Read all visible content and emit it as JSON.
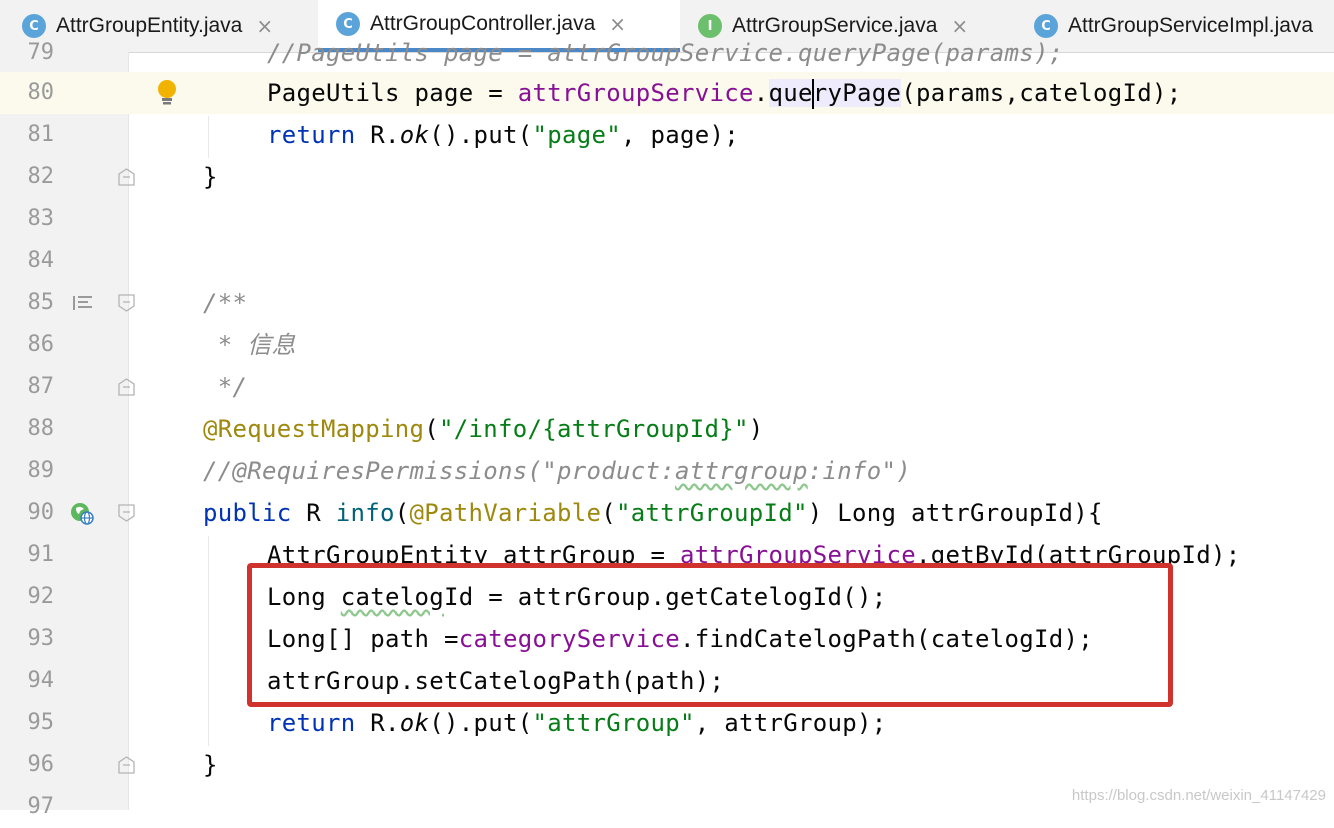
{
  "tabs": [
    {
      "label": "AttrGroupEntity.java",
      "icon": "C",
      "active": false
    },
    {
      "label": "AttrGroupController.java",
      "icon": "C",
      "active": true
    },
    {
      "label": "AttrGroupService.java",
      "icon": "I",
      "active": false
    },
    {
      "label": "AttrGroupServiceImpl.java",
      "icon": "C",
      "active": false
    }
  ],
  "tab_close_glyph": "×",
  "lines": [
    {
      "num": "79",
      "text": "//PageUtils page = attrGroupService.queryPage(params);"
    },
    {
      "num": "80",
      "text": "PageUtils page = attrGroupService.queryPage(params,catelogId);"
    },
    {
      "num": "81",
      "text": "return R.ok().put(\"page\", page);"
    },
    {
      "num": "82",
      "text": "}"
    },
    {
      "num": "83",
      "text": ""
    },
    {
      "num": "84",
      "text": ""
    },
    {
      "num": "85",
      "text": "/**"
    },
    {
      "num": "86",
      "text": " * 信息"
    },
    {
      "num": "87",
      "text": " */"
    },
    {
      "num": "88",
      "text": "@RequestMapping(\"/info/{attrGroupId}\")"
    },
    {
      "num": "89",
      "text": "//@RequiresPermissions(\"product:attrgroup:info\")"
    },
    {
      "num": "90",
      "text": "public R info(@PathVariable(\"attrGroupId\") Long attrGroupId){"
    },
    {
      "num": "91",
      "text": "AttrGroupEntity attrGroup = attrGroupService.getById(attrGroupId);"
    },
    {
      "num": "92",
      "text": "Long catelogId = attrGroup.getCatelogId();"
    },
    {
      "num": "93",
      "text": "Long[] path =categoryService.findCatelogPath(catelogId);"
    },
    {
      "num": "94",
      "text": "attrGroup.setCatelogPath(path);"
    },
    {
      "num": "95",
      "text": "return R.ok().put(\"attrGroup\", attrGroup);"
    },
    {
      "num": "96",
      "text": "}"
    },
    {
      "num": "97",
      "text": ""
    }
  ],
  "watermark": "https://blog.csdn.net/weixin_41147429",
  "colors": {
    "keyword": "#0033b3",
    "string": "#067d17",
    "field": "#871094",
    "annotation": "#9e880d",
    "comment": "#8c8c8c",
    "highlight_box": "#d0322d",
    "active_tab_underline": "#4a88c7"
  }
}
